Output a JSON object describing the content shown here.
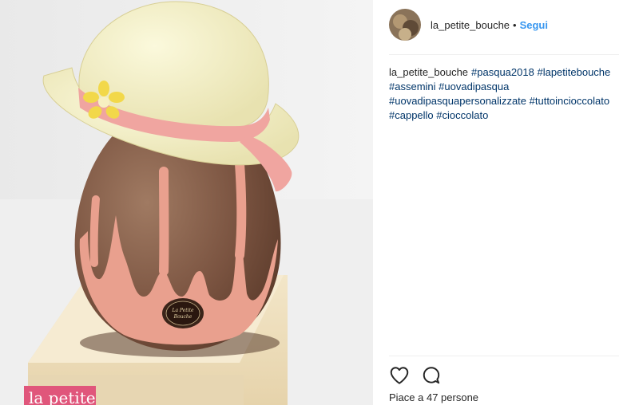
{
  "post": {
    "username": "la_petite_bouche",
    "separator": "•",
    "follow_label": "Segui",
    "caption_user": "la_petite_bouche",
    "hashtags": [
      "#pasqua2018",
      "#lapetitebouche",
      "#assemini",
      "#uovadipasqua",
      "#uovadipasquapersonalizzate",
      "#tuttoincioccolato",
      "#cappello",
      "#cioccolato"
    ],
    "likes_text": "Piace a 47 persone"
  },
  "photo": {
    "plaque_text_line1": "La Petite",
    "plaque_text_line2": "Bouche",
    "box_label": "la petite"
  },
  "icons": {
    "like": "heart-icon",
    "comment": "comment-icon"
  },
  "colors": {
    "follow": "#3897f0",
    "hashtag": "#003569",
    "text": "#262626"
  }
}
